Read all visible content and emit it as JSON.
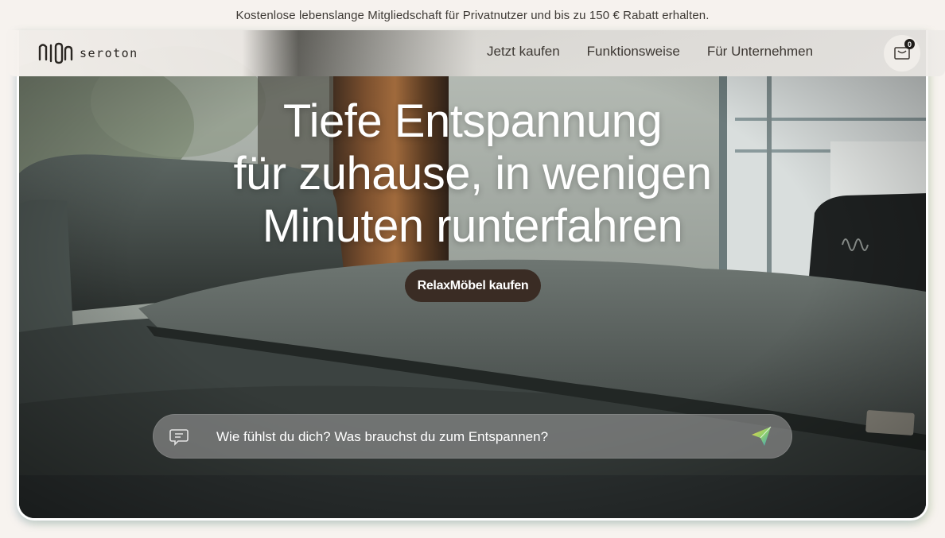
{
  "announcement": "Kostenlose lebenslange Mitgliedschaft für Privatnutzer und bis zu 150 € Rabatt erhalten.",
  "brand": {
    "name": "seroton"
  },
  "nav": {
    "items": [
      {
        "label": "Jetzt kaufen"
      },
      {
        "label": "Funktionsweise"
      },
      {
        "label": "Für Unternehmen"
      }
    ]
  },
  "cart": {
    "count": "0",
    "icon": "shopping-bag-icon"
  },
  "hero": {
    "headline_lines": [
      "Tiefe Entspannung",
      "für zuhause, in wenigen",
      "Minuten runterfahren"
    ],
    "cta_label": "RelaxMöbel kaufen"
  },
  "chat": {
    "placeholder": "Wie fühlst du dich? Was brauchst du zum Entspannen?",
    "value": "",
    "left_icon": "chat-bubble-icon",
    "right_icon": "send-icon"
  },
  "colors": {
    "announcement_bg": "#f6f2ee",
    "cta_bg": "#3a2c24",
    "text_dark": "#3d3833"
  }
}
